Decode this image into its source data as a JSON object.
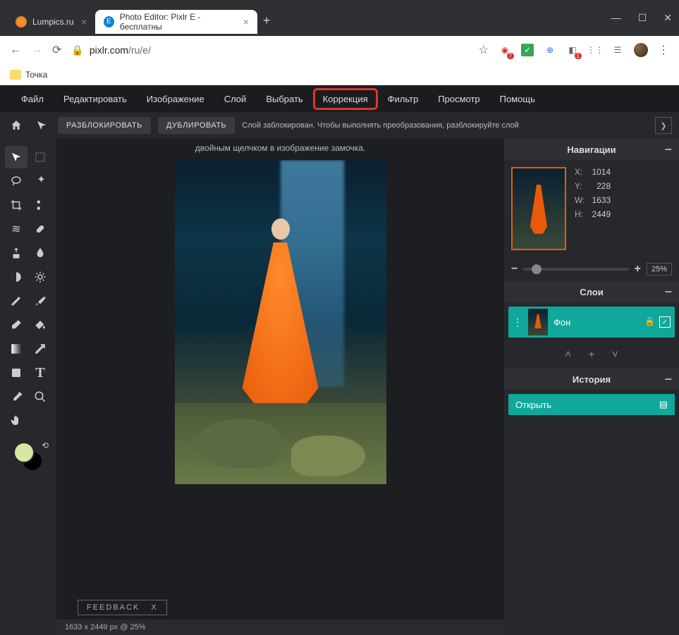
{
  "window": {
    "tabs": [
      {
        "title": "Lumpics.ru",
        "favicon": "orange"
      },
      {
        "title": "Photo Editor: Pixlr E - бесплатны",
        "favicon": "E"
      }
    ]
  },
  "url": {
    "domain": "pixlr.com",
    "path": "/ru/e/"
  },
  "bookmarks": {
    "item1": "Точка"
  },
  "menu": {
    "file": "Файл",
    "edit": "Редактировать",
    "image": "Изображение",
    "layer": "Слой",
    "select": "Выбрать",
    "adjustment": "Коррекция",
    "filter": "Фильтр",
    "view": "Просмотр",
    "help": "Помощь"
  },
  "toolbar": {
    "unlock": "РАЗБЛОКИРОВАТЬ",
    "duplicate": "ДУБЛИРОВАТЬ",
    "hint": "Слой заблокирован. Чтобы выполнять преобразования, разблокируйте слой",
    "hint2": "двойным щелчком в изображение замочка."
  },
  "nav": {
    "title": "Навигации",
    "x_label": "X:",
    "x": "1014",
    "y_label": "Y:",
    "y": "228",
    "w_label": "W:",
    "w": "1633",
    "h_label": "H:",
    "h": "2449",
    "zoom": "25%"
  },
  "layers_panel": {
    "title": "Слои",
    "item1": "Фон"
  },
  "history_panel": {
    "title": "История",
    "item1": "Открыть"
  },
  "feedback": {
    "label": "FEEDBACK",
    "close": "X"
  },
  "status": {
    "dims": "1633 x 2449 px @ 25%"
  },
  "ext_badges": {
    "b1": "7",
    "b2": "1"
  }
}
